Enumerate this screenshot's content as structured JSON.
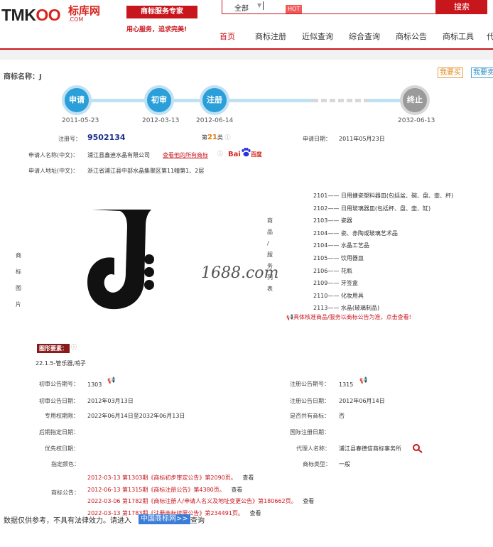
{
  "header": {
    "logo_prefix": "TMK",
    "logo_oo": "OO",
    "logo_cn": "标库网",
    "logo_com": ".COM",
    "slogan_badge": "商标服务专家",
    "slogan_sub": "用心服务，追求完美!",
    "search_select": "全部",
    "hot_badge": "HOT",
    "search_button": "搜索"
  },
  "nav": {
    "home": "首页",
    "register": "商标注册",
    "similar": "近似查询",
    "combined": "综合查询",
    "announce": "商标公告",
    "tools": "商标工具",
    "more": "代"
  },
  "trademark": {
    "name_label": "商标名称：J",
    "buy_button": "我要买",
    "sell_button": "我要卖"
  },
  "timeline": {
    "steps": [
      {
        "label": "申请",
        "date": "2011-05-23"
      },
      {
        "label": "初审",
        "date": "2012-03-13"
      },
      {
        "label": "注册",
        "date": "2012-06-14"
      },
      {
        "label": "终止",
        "date": "2032-06-13"
      }
    ]
  },
  "info": {
    "reg_no_label": "注册号：",
    "reg_no": "9502134",
    "class_prefix": "第",
    "class_num": "21",
    "class_suffix": "类",
    "apply_date_label": "申请日期：",
    "apply_date": "2011年05月23日",
    "applicant_label": "申请人名称(中文)：",
    "applicant": "浦江县鑫迪水晶有限公司",
    "applicant_link": "查看他的所有商标",
    "baidu_label": "Bai",
    "baidu_suffix": "百度",
    "address_label": "申请人地址(中文)：",
    "address": "浙江省浦江县中部水晶集聚区第11幢第1、2层"
  },
  "image_section": {
    "side_label": [
      "商",
      "标",
      "图",
      "片"
    ],
    "goods_label": [
      "商",
      "品",
      "/",
      "服",
      "务",
      "列",
      "表"
    ],
    "watermark": "1688.com"
  },
  "goods": [
    {
      "code": "2101",
      "name": "日用搪瓷塑料器皿(包括盆、碗、盘、壶、杯)"
    },
    {
      "code": "2102",
      "name": "日用玻璃器皿(包括杯、盘、壶、缸)"
    },
    {
      "code": "2103",
      "name": "瓷器"
    },
    {
      "code": "2104",
      "name": "瓷、赤陶或玻璃艺术品"
    },
    {
      "code": "2104",
      "name": "水晶工艺品"
    },
    {
      "code": "2105",
      "name": "饮用器皿"
    },
    {
      "code": "2106",
      "name": "花瓶"
    },
    {
      "code": "2109",
      "name": "牙签盒"
    },
    {
      "code": "2110",
      "name": "化妆用具"
    },
    {
      "code": "2113",
      "name": "水晶(玻璃制品)"
    }
  ],
  "goods_note": "具体核准商品/服务以商标公告为准，点击查看!",
  "figure": {
    "badge": "图形要素：",
    "code": "22.1.5-管乐器,哨子"
  },
  "details": {
    "prelim_no_label": "初审公告期号：",
    "prelim_no": "1303",
    "reg_ann_no_label": "注册公告期号：",
    "reg_ann_no": "1315",
    "prelim_date_label": "初审公告日期：",
    "prelim_date": "2012年03月13日",
    "reg_ann_date_label": "注册公告日期：",
    "reg_ann_date": "2012年06月14日",
    "exclusive_label": "专用权期限：",
    "exclusive": "2022年06月14日至2032年06月13日",
    "shared_label": "是否共有商标：",
    "shared": "否",
    "later_label": "后期指定日期：",
    "intl_label": "国际注册日期：",
    "priority_label": "优先权日期：",
    "agent_label": "代理人名称：",
    "agent": "浦江县春德信商标事务所",
    "color_label": "指定颜色：",
    "type_label": "商标类型：",
    "type": "一般",
    "announce_label": "商标公告："
  },
  "announcements": [
    {
      "text": "2012-03-13 第1303期《商标初步审定公告》第2090页。",
      "view": "查看"
    },
    {
      "text": "2012-06-13 第1315期《商标注册公告》第4380页。",
      "view": "查看"
    },
    {
      "text": "2022-03-06 第1782期《商标注册人/申请人名义及地址变更公告》第180662页。",
      "view": "查看"
    },
    {
      "text": "2022-03-13 第1783期《注册商标续展公告》第234491页。",
      "view": "查看"
    }
  ],
  "footer": {
    "text": "数据仅供参考，不具有法律效力。请进入",
    "link": "中国商标网>>",
    "tail": "查询"
  },
  "colors": {
    "brand": "#c8161d",
    "timeline_active": "#2b9fd9",
    "timeline_inactive": "#9a9a9a",
    "reg_no": "#1a2f8c"
  }
}
